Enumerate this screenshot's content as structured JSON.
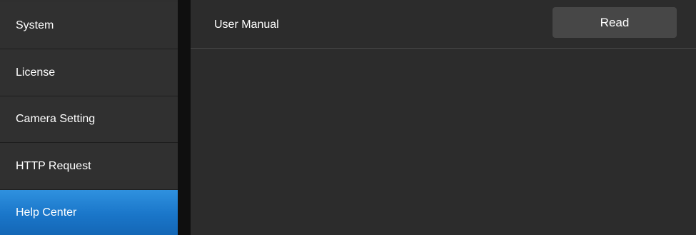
{
  "sidebar": {
    "items": [
      {
        "label": "System"
      },
      {
        "label": "License"
      },
      {
        "label": "Camera Setting"
      },
      {
        "label": "HTTP Request"
      },
      {
        "label": "Help Center"
      }
    ],
    "active": "Help Center",
    "active_color": "#1a76c9"
  },
  "main": {
    "rows": [
      {
        "label": "User Manual",
        "button": "Read"
      }
    ]
  }
}
